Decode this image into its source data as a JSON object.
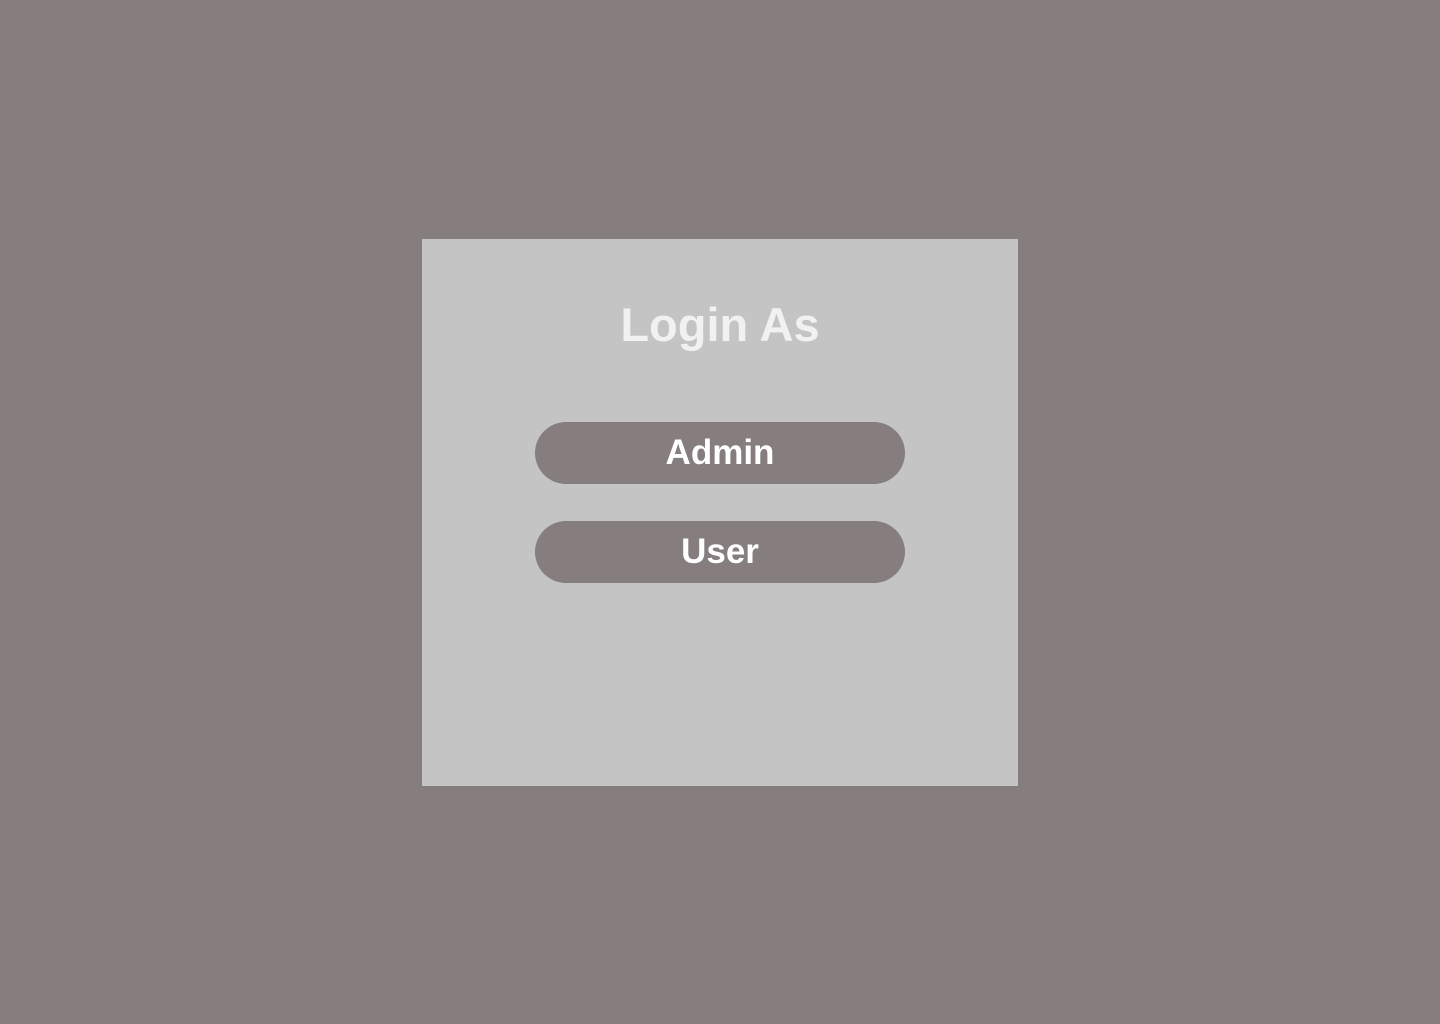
{
  "login": {
    "title": "Login As",
    "buttons": [
      {
        "label": "Admin"
      },
      {
        "label": "User"
      }
    ]
  },
  "colors": {
    "page_background": "#867d7e",
    "card_background": "#c4c4c4",
    "button_background": "#867d7e",
    "title_text": "#f2f0f0",
    "button_text": "#ffffff"
  }
}
